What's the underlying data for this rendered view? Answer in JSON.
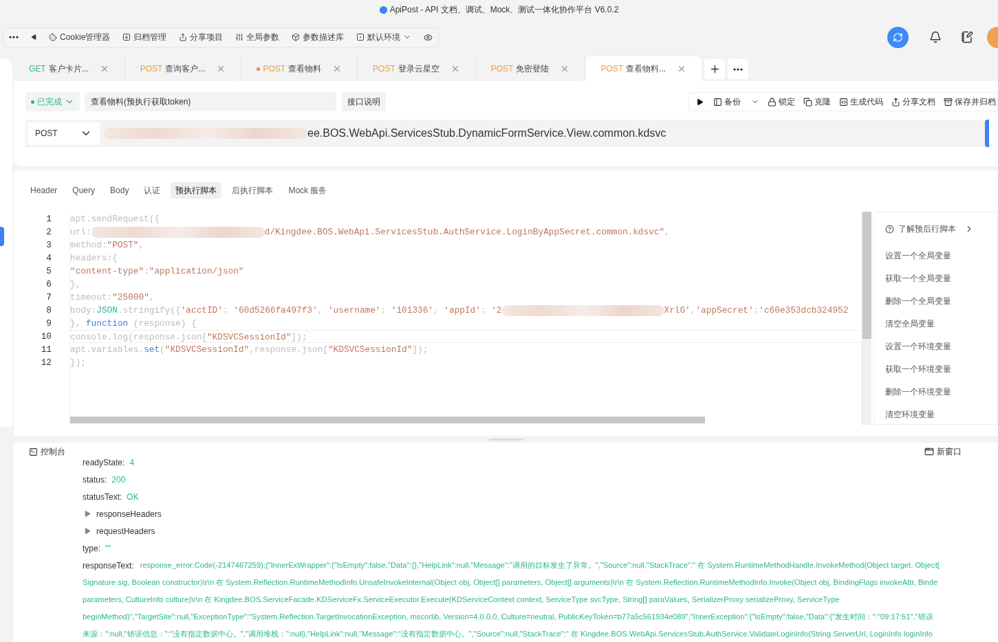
{
  "window": {
    "title": "ApiPost - API 文档、调试、Mock、测试一体化协作平台 V6.0.2"
  },
  "toolbar": {
    "items": [
      {
        "kind": "cookie",
        "label": "Cookie管理器"
      },
      {
        "kind": "archive",
        "label": "归档管理"
      },
      {
        "kind": "share",
        "label": "分享项目"
      },
      {
        "kind": "params",
        "label": "全局参数"
      },
      {
        "kind": "box",
        "label": "参数描述库"
      },
      {
        "kind": "env",
        "label": "默认环境"
      }
    ]
  },
  "tabs": [
    {
      "method": "GET",
      "title": "客户卡片...",
      "selected": false,
      "modified": false
    },
    {
      "method": "POST",
      "title": "查询客户...",
      "selected": false,
      "modified": false
    },
    {
      "method": "POST",
      "title": "查看物料",
      "selected": false,
      "modified": true
    },
    {
      "method": "POST",
      "title": "登录云星空",
      "selected": false,
      "modified": false
    },
    {
      "method": "POST",
      "title": "免密登陆",
      "selected": false,
      "modified": false
    },
    {
      "method": "POST",
      "title": "查看物料...",
      "selected": true,
      "modified": false
    }
  ],
  "request": {
    "status": "已完成",
    "name": "查看物料(预执行获取token)",
    "doc_button": "接口说明",
    "actions": [
      {
        "kind": "backup",
        "label": "备份"
      },
      {
        "kind": "lock",
        "label": "锁定"
      },
      {
        "kind": "clone",
        "label": "克隆"
      },
      {
        "kind": "code",
        "label": "生成代码"
      },
      {
        "kind": "share",
        "label": "分享文档"
      },
      {
        "kind": "save",
        "label": "保存并归档"
      }
    ],
    "method": "POST",
    "url_visible": "ee.BOS.WebApi.ServicesStub.DynamicFormService.View.common.kdsvc"
  },
  "sub_tabs": [
    {
      "label": "Header",
      "selected": false
    },
    {
      "label": "Query",
      "selected": false
    },
    {
      "label": "Body",
      "selected": false
    },
    {
      "label": "认证",
      "selected": false
    },
    {
      "label": "预执行脚本",
      "selected": true
    },
    {
      "label": "后执行脚本",
      "selected": false
    },
    {
      "label": "Mock 服务",
      "selected": false
    }
  ],
  "editor": {
    "lines": [
      {
        "number": "1",
        "segments": [
          {
            "kind": "plain",
            "text": "apt.sendRequest({"
          }
        ]
      },
      {
        "number": "2",
        "segments": [
          {
            "kind": "plain",
            "text": "url:"
          },
          {
            "kind": "blur"
          },
          {
            "kind": "string",
            "text": "d/Kingdee.BOS.WebApi.ServicesStub.AuthService.LoginByAppSecret.common.kdsvc\""
          },
          {
            "kind": "plain",
            "text": ","
          }
        ]
      },
      {
        "number": "3",
        "segments": [
          {
            "kind": "plain",
            "text": "method:"
          },
          {
            "kind": "string",
            "text": "\"POST\""
          },
          {
            "kind": "plain",
            "text": ","
          }
        ]
      },
      {
        "number": "4",
        "segments": [
          {
            "kind": "plain",
            "text": "headers:{"
          }
        ]
      },
      {
        "number": "5",
        "segments": [
          {
            "kind": "string",
            "text": "\"content-type\""
          },
          {
            "kind": "plain",
            "text": ":"
          },
          {
            "kind": "string",
            "text": "\"application/json\""
          }
        ]
      },
      {
        "number": "6",
        "segments": [
          {
            "kind": "plain",
            "text": "},"
          }
        ]
      },
      {
        "number": "7",
        "segments": [
          {
            "kind": "plain",
            "text": "timeout:"
          },
          {
            "kind": "string",
            "text": "\"25000\""
          },
          {
            "kind": "plain",
            "text": ","
          }
        ]
      },
      {
        "number": "8",
        "segments": [
          {
            "kind": "plain",
            "text": "body:"
          },
          {
            "kind": "builtin",
            "text": "JSON"
          },
          {
            "kind": "plain",
            "text": ".stringify({"
          },
          {
            "kind": "string",
            "text": "'acctID'"
          },
          {
            "kind": "plain",
            "text": ": "
          },
          {
            "kind": "string",
            "text": "'60d5266fa497f3'"
          },
          {
            "kind": "plain",
            "text": ", "
          },
          {
            "kind": "string",
            "text": "'username'"
          },
          {
            "kind": "plain",
            "text": ": "
          },
          {
            "kind": "string",
            "text": "'101336'"
          },
          {
            "kind": "plain",
            "text": ", "
          },
          {
            "kind": "string",
            "text": "'appId'"
          },
          {
            "kind": "plain",
            "text": ": "
          },
          {
            "kind": "string",
            "text": "'2"
          },
          {
            "kind": "blur"
          },
          {
            "kind": "string",
            "text": "XrlG'"
          },
          {
            "kind": "plain",
            "text": ","
          },
          {
            "kind": "string",
            "text": "'appSecret'"
          },
          {
            "kind": "plain",
            "text": ":"
          },
          {
            "kind": "string",
            "text": "'c60e353dcb324952"
          }
        ]
      },
      {
        "number": "9",
        "segments": [
          {
            "kind": "plain",
            "text": "}, "
          },
          {
            "kind": "keyword",
            "text": "function"
          },
          {
            "kind": "plain",
            "text": " (response) {"
          }
        ]
      },
      {
        "number": "10",
        "segments": [
          {
            "kind": "plain",
            "text": "console.log(response.json["
          },
          {
            "kind": "string",
            "text": "\"KDSVCSessionId\""
          },
          {
            "kind": "plain",
            "text": "]);"
          }
        ]
      },
      {
        "number": "11",
        "segments": [
          {
            "kind": "plain",
            "text": "apt.variables."
          },
          {
            "kind": "keyword",
            "text": "set"
          },
          {
            "kind": "plain",
            "text": "("
          },
          {
            "kind": "string",
            "text": "\"KDSVCSessionId\""
          },
          {
            "kind": "plain",
            "text": ",response.json["
          },
          {
            "kind": "string",
            "text": "\"KDSVCSessionId\""
          },
          {
            "kind": "plain",
            "text": "]);"
          }
        ]
      },
      {
        "number": "12",
        "segments": [
          {
            "kind": "plain",
            "text": "});"
          }
        ]
      }
    ]
  },
  "snippets": {
    "help": "了解预后行脚本",
    "items": [
      "设置一个全局变量",
      "获取一个全局变量",
      "删除一个全局变量",
      "清空全局变量",
      "设置一个环境变量",
      "获取一个环境变量",
      "删除一个环境变量",
      "清空环境变量"
    ]
  },
  "console": {
    "title": "控制台",
    "new_window": "新窗口",
    "rows": [
      {
        "kind": "field",
        "key": "readyState:",
        "value": "4"
      },
      {
        "kind": "field",
        "key": "status:",
        "value": "200"
      },
      {
        "kind": "field",
        "key": "statusText:",
        "value": "OK"
      },
      {
        "kind": "group",
        "key": "responseHeaders",
        "expanded": false
      },
      {
        "kind": "group",
        "key": "requestHeaders",
        "expanded": false
      },
      {
        "kind": "field",
        "key": "type:",
        "value": "\"\""
      },
      {
        "kind": "long",
        "key": "responseText:",
        "lines": [
          "response_error:Code(-2147467259);{\"InnerExWrapper\":{\"IsEmpty\":false,\"Data\":{},\"HelpLink\":null,\"Message\":\"调用的目标发生了异常。\",\"Source\":null,\"StackTrace\":\" 在 System.RuntimeMethodHandle.InvokeMethod(Object target, Object[",
          "Signature sig, Boolean constructor)\\r\\n 在 System.Reflection.RuntimeMethodInfo.UnsafeInvokeInternal(Object obj, Object[] parameters, Object[] arguments)\\r\\n 在 System.Reflection.RuntimeMethodInfo.Invoke(Object obj, BindingFlags invokeAttr, Binde",
          "parameters, CultureInfo culture)\\r\\n 在 Kingdee.BOS.ServiceFacade.KDServiceFx.ServiceExecutor.Execute(KDServiceContext context, ServiceType svcType, String[] paraValues, SerializerProxy serializeProxy, ServiceType",
          "beginMethod)\",\"TargetSite\":null,\"ExceptionType\":\"System.Reflection.TargetInvocationException, mscorlib, Version=4.0.0.0, Culture=neutral, PublicKeyToken=b77a5c561934e089\",\"InnerException\":{\"IsEmpty\":false,\"Data\":{\"发生时间：\":\"09:17:51\",\"错误",
          "来源：\":null,\"错误信息：\":\"没有指定数据中心。\",\"调用堆栈：\":null},\"HelpLink\":null,\"Message\":\"没有指定数据中心。\",\"Source\":null,\"StackTrace\":\" 在 Kingdee.BOS.WebApi.ServicesStub.AuthService.ValidateLoginInfo(String ServerUrl, LoginInfo loginInfo"
        ]
      }
    ]
  }
}
